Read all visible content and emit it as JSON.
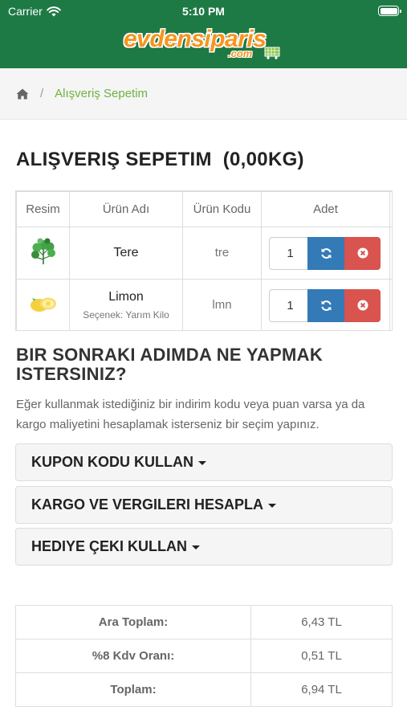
{
  "status_bar": {
    "carrier": "Carrier",
    "time": "5:10 PM"
  },
  "header": {
    "logo_text": "evdensiparis",
    "logo_suffix": ".com"
  },
  "breadcrumb": {
    "home_icon": "home-icon",
    "separator": "/",
    "current": "Alışveriş Sepetim"
  },
  "cart": {
    "title": "ALIŞVERIŞ SEPETIM  (0,00KG)",
    "columns": [
      "Resim",
      "Ürün Adı",
      "Ürün Kodu",
      "Adet"
    ],
    "items": [
      {
        "name": "Tere",
        "option": "",
        "code": "tre",
        "quantity": "1",
        "image_icon": "watercress-icon"
      },
      {
        "name": "Limon",
        "option": "Seçenek: Yarım Kilo",
        "code": "lmn",
        "quantity": "1",
        "image_icon": "lemon-icon"
      }
    ],
    "refresh_icon": "refresh-icon",
    "remove_icon": "remove-icon"
  },
  "next_step": {
    "title": "BIR SONRAKI ADIMDA NE YAPMAK ISTERSINIZ?",
    "description": "Eğer kullanmak istediğiniz bir indirim kodu veya puan varsa ya da kargo maliyetini hesaplamak isterseniz bir seçim yapınız.",
    "panels": [
      "KUPON KODU KULLAN",
      "KARGO VE VERGILERI HESAPLA",
      "HEDIYE ÇEKI KULLAN"
    ]
  },
  "totals": [
    {
      "label": "Ara Toplam:",
      "value": "6,43 TL"
    },
    {
      "label": "%8 Kdv Oranı:",
      "value": "0,51 TL"
    },
    {
      "label": "Toplam:",
      "value": "6,94 TL"
    }
  ],
  "colors": {
    "header_green": "#1e7a45",
    "logo_orange": "#f7941d",
    "breadcrumb_active": "#6cb33f",
    "refresh_blue": "#337ab7",
    "remove_red": "#d9534f"
  }
}
